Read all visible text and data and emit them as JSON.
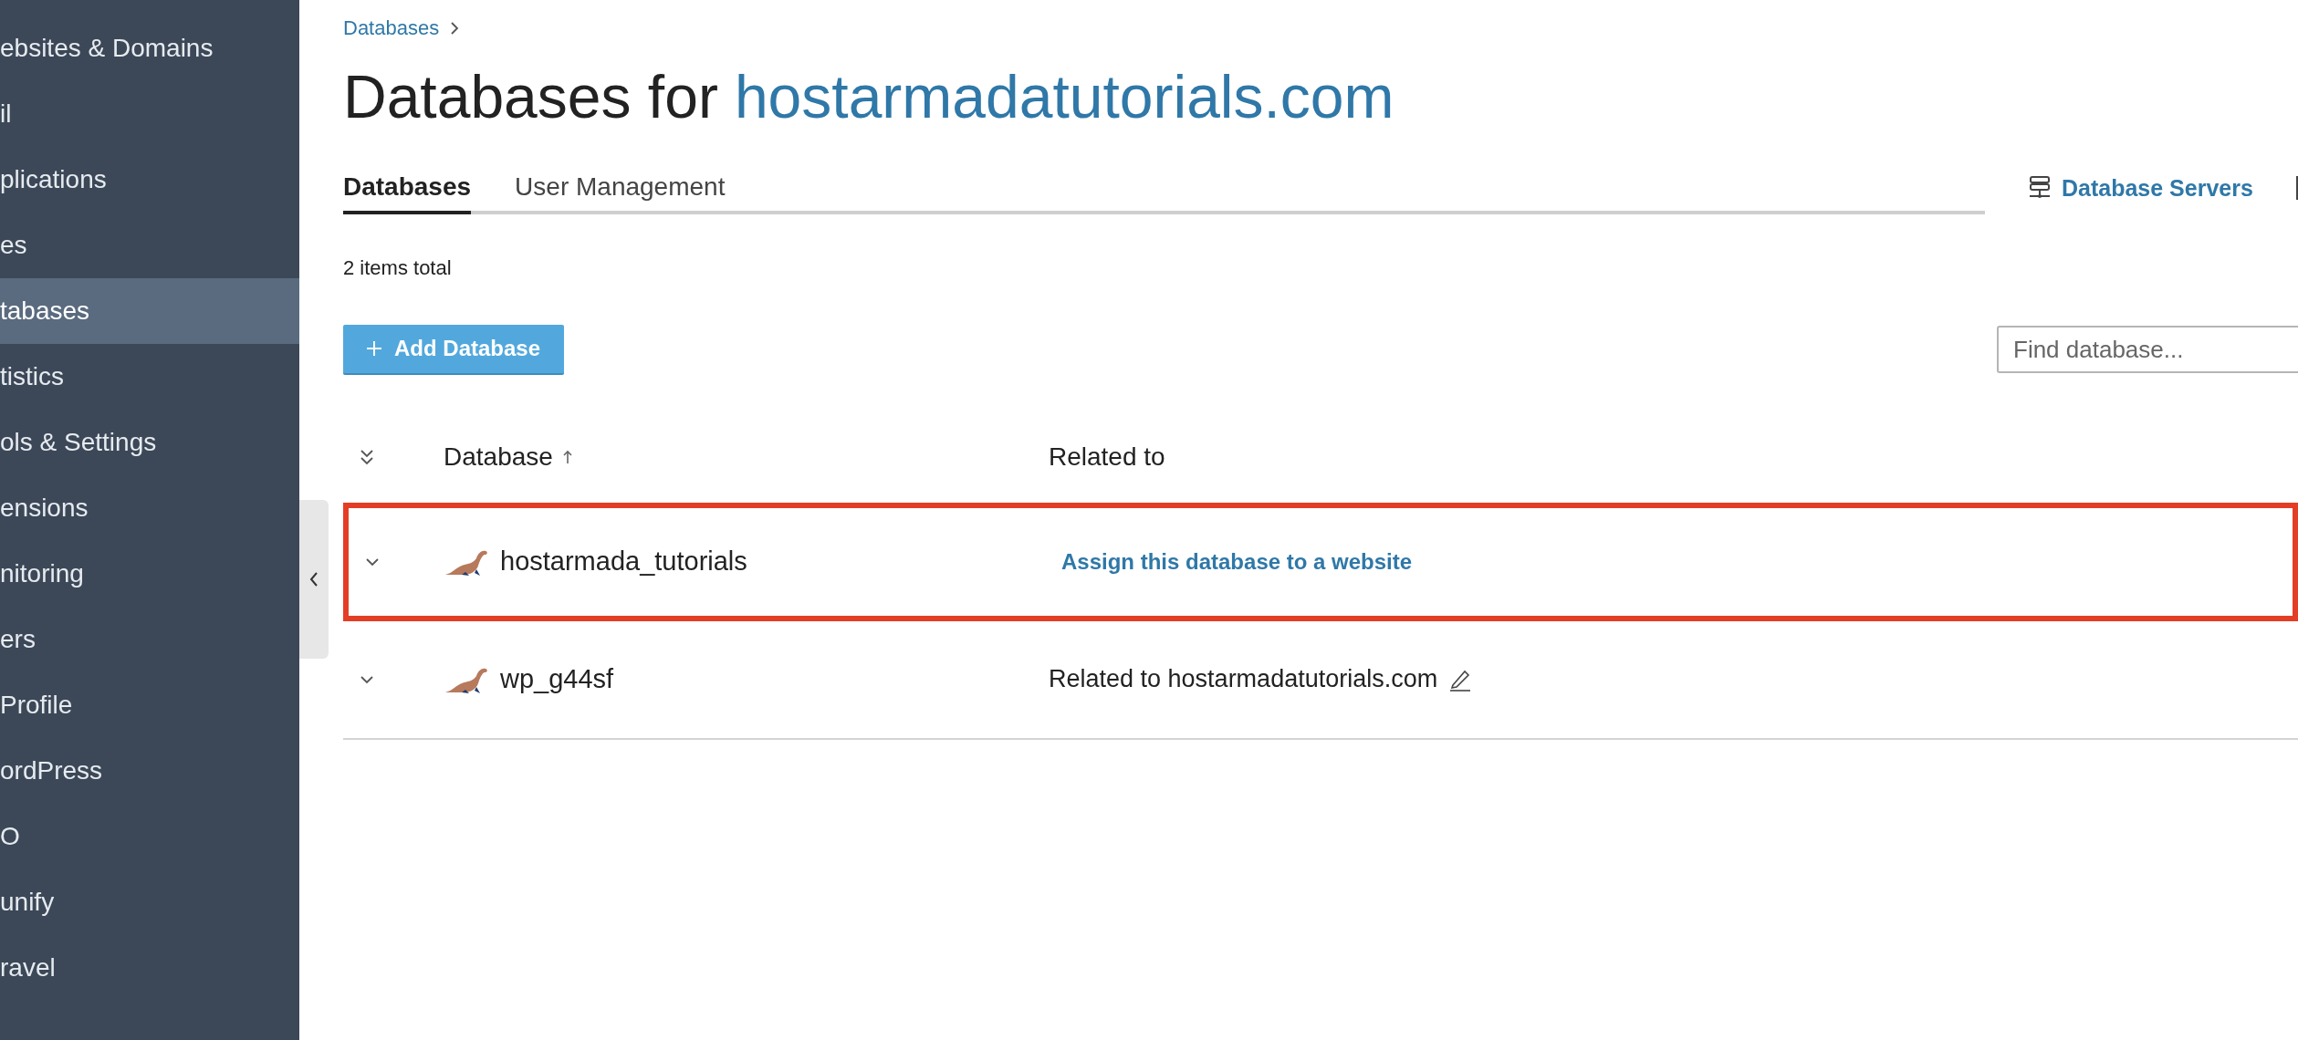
{
  "sidebar": {
    "items": [
      {
        "label": "ebsites & Domains",
        "selected": false
      },
      {
        "label": "il",
        "selected": false
      },
      {
        "label": "plications",
        "selected": false
      },
      {
        "label": "es",
        "selected": false
      },
      {
        "label": "tabases",
        "selected": true
      },
      {
        "label": "tistics",
        "selected": false
      },
      {
        "label": "ols & Settings",
        "selected": false
      },
      {
        "label": "ensions",
        "selected": false
      },
      {
        "label": "nitoring",
        "selected": false
      },
      {
        "label": "ers",
        "selected": false
      },
      {
        "label": " Profile",
        "selected": false
      },
      {
        "label": "ordPress",
        "selected": false
      },
      {
        "label": "O",
        "selected": false
      },
      {
        "label": "unify",
        "selected": false
      },
      {
        "label": "ravel",
        "selected": false
      }
    ]
  },
  "breadcrumb": [
    {
      "label": "Databases"
    }
  ],
  "title": {
    "prefix": "Databases for",
    "domain": "hostarmadatutorials.com"
  },
  "tabs": [
    {
      "label": "Databases",
      "selected": true
    },
    {
      "label": "User Management",
      "selected": false
    }
  ],
  "links": [
    {
      "label": "Database Servers"
    }
  ],
  "items_total": "2 items total",
  "add_button": "Add Database",
  "search": {
    "placeholder": "Find database..."
  },
  "table": {
    "columns": [
      {
        "label": "Database",
        "sorted": true
      },
      {
        "label": "Related to",
        "sorted": false
      }
    ],
    "rows": [
      {
        "name": "hostarmada_tutorials",
        "related": {
          "kind": "link",
          "text": "Assign this database to a website"
        },
        "editable": false,
        "highlighted": true
      },
      {
        "name": "wp_g44sf",
        "related": {
          "kind": "text",
          "text": "Related to hostarmadatutorials.com"
        },
        "editable": true,
        "highlighted": false
      }
    ]
  }
}
